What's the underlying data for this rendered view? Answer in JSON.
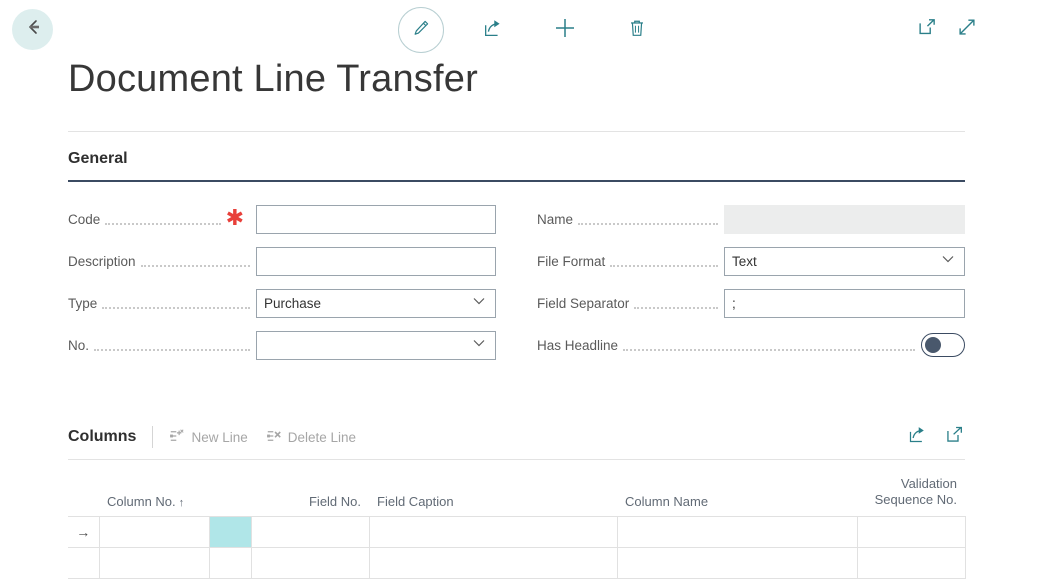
{
  "topbar": {
    "back_label": "Back",
    "back_icon": "arrow-left-icon",
    "commands": [
      {
        "name": "edit-button",
        "icon": "pencil-icon",
        "label": "Edit",
        "ringed": true
      },
      {
        "name": "share-button",
        "icon": "share-icon",
        "label": "Share",
        "ringed": false
      },
      {
        "name": "new-button",
        "icon": "plus-icon",
        "label": "New",
        "ringed": false
      },
      {
        "name": "delete-button",
        "icon": "trash-icon",
        "label": "Delete",
        "ringed": false
      }
    ],
    "right_commands": [
      {
        "name": "open-in-new-window-button",
        "icon": "open-in-new-icon",
        "label": "Open in new window"
      },
      {
        "name": "expand-button",
        "icon": "expand-arrow-icon",
        "label": "Expand"
      }
    ]
  },
  "page": {
    "title": "Document Line Transfer"
  },
  "general": {
    "heading": "General",
    "left_fields": [
      {
        "label": "Code",
        "value": "",
        "placeholder": "",
        "control": "text",
        "required": true
      },
      {
        "label": "Description",
        "value": "",
        "placeholder": "",
        "control": "text",
        "required": false
      },
      {
        "label": "Type",
        "value": "Purchase",
        "placeholder": "",
        "control": "dropdown",
        "required": false
      },
      {
        "label": "No.",
        "value": "",
        "placeholder": "",
        "control": "dropdown",
        "required": false
      }
    ],
    "right_fields": [
      {
        "label": "Name",
        "value": "",
        "placeholder": "",
        "control": "readonly",
        "required": false
      },
      {
        "label": "File Format",
        "value": "Text",
        "placeholder": "",
        "control": "dropdown",
        "required": false
      },
      {
        "label": "Field Separator",
        "value": ";",
        "placeholder": "",
        "control": "text",
        "required": false
      },
      {
        "label": "Has Headline",
        "value": "",
        "placeholder": "",
        "control": "toggle",
        "toggle_on": false,
        "required": false
      }
    ]
  },
  "columns_part": {
    "title": "Columns",
    "actions": [
      {
        "name": "new-line-button",
        "label": "New Line",
        "icon": "new-line-icon",
        "enabled": false
      },
      {
        "name": "delete-line-button",
        "label": "Delete Line",
        "icon": "delete-line-icon",
        "enabled": false
      }
    ],
    "right_icons": [
      {
        "name": "share-part-button",
        "icon": "share-icon",
        "label": "Share"
      },
      {
        "name": "expand-part-button",
        "icon": "open-in-new-icon",
        "label": "Open in full view"
      }
    ],
    "grid": {
      "headers": [
        {
          "label": "Column No.",
          "align": "left",
          "sorted": true,
          "sort_dir": "ascending",
          "sort_caret": "↑"
        },
        {
          "label": "Field No.",
          "align": "right",
          "sorted": false,
          "sort_dir": "",
          "sort_caret": ""
        },
        {
          "label": "Field Caption",
          "align": "left",
          "sorted": false,
          "sort_dir": "",
          "sort_caret": ""
        },
        {
          "label": "Column Name",
          "align": "left",
          "sorted": false,
          "sort_dir": "",
          "sort_caret": ""
        },
        {
          "label": "Validation Sequence No.",
          "align": "right",
          "sorted": false,
          "sort_dir": "",
          "sort_caret": "",
          "line1": "Validation",
          "line2": "Sequence No."
        }
      ],
      "row_indicator": "→",
      "rows": [
        {
          "current": true,
          "indicator": "→",
          "cells": [
            {
              "value": "",
              "selected": false
            },
            {
              "value": "",
              "selected": true
            },
            {
              "value": "",
              "selected": false
            },
            {
              "value": "",
              "selected": false
            },
            {
              "value": "",
              "selected": false
            }
          ]
        },
        {
          "current": false,
          "indicator": "",
          "cells": [
            {
              "value": "",
              "selected": false
            },
            {
              "value": "",
              "selected": false
            },
            {
              "value": "",
              "selected": false
            },
            {
              "value": "",
              "selected": false
            },
            {
              "value": "",
              "selected": false
            }
          ]
        }
      ]
    }
  },
  "colors": {
    "accent_teal": "#2a7f89",
    "back_circle": "#ddeeee",
    "section_rule": "#3b4b62",
    "required_star": "#e8403a",
    "cell_selected": "#b0e6e8",
    "label_text": "#5a5a5a",
    "grid_border": "#e1e1e1"
  }
}
